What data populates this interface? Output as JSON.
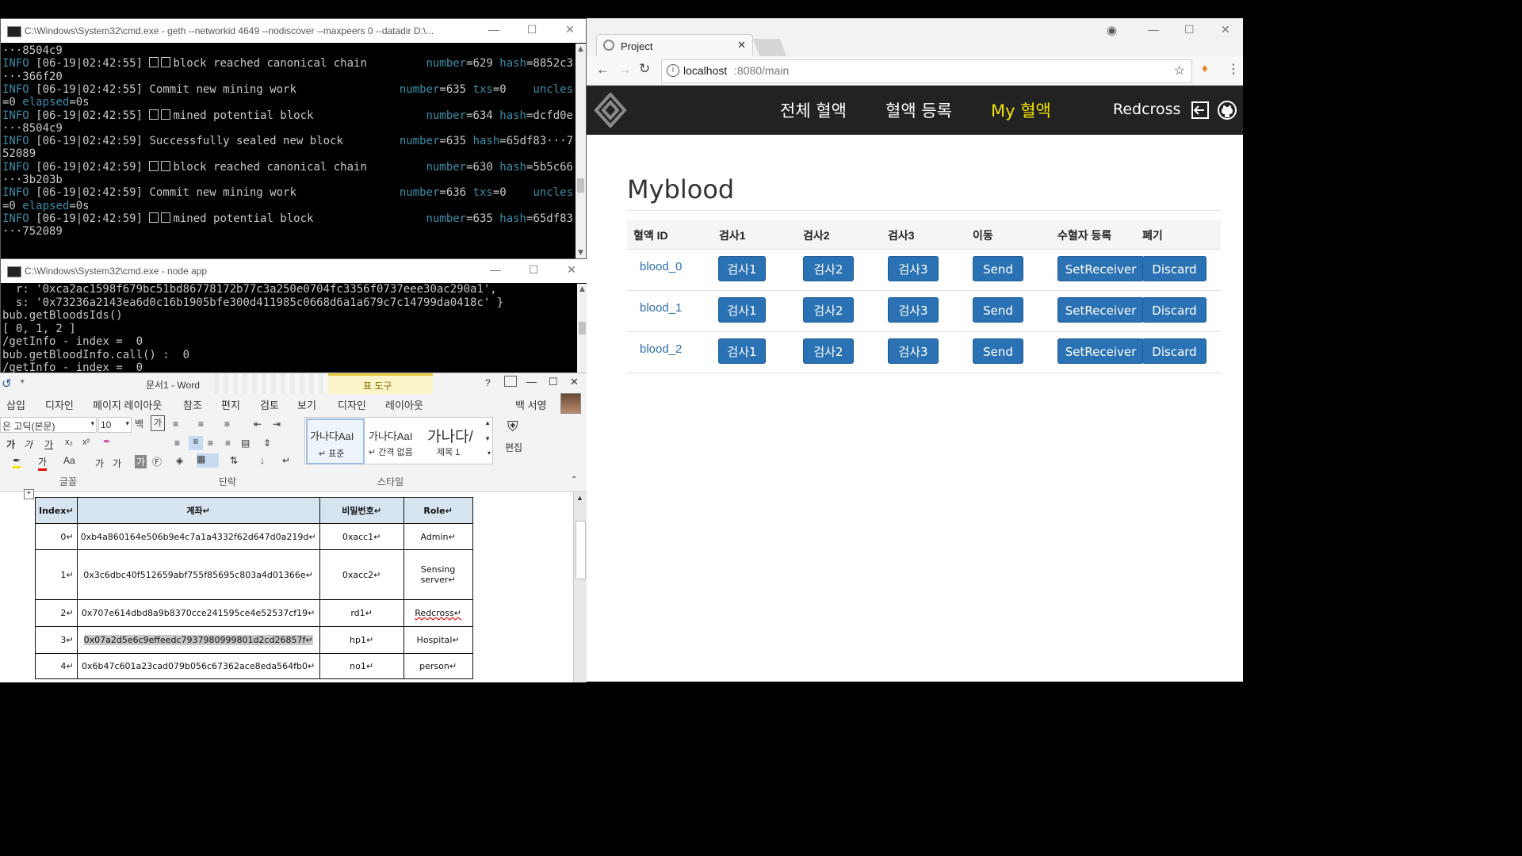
{
  "cmd1": {
    "title": "C:\\Windows\\System32\\cmd.exe - geth  --networkid 4649 --nodiscover --maxpeers 0 --datadir D:\\...",
    "lines": [
      {
        "pre": "",
        "text": "···8504c9",
        "kv": ""
      },
      {
        "pre": "INFO",
        "text": " [06-19|02:42:55] ",
        "msg": "block reached canonical chain",
        "sq": true,
        "kv1k": "number",
        "kv1v": "=629",
        "kv2k": "hash",
        "kv2v": "=8852c3"
      },
      {
        "pre": "",
        "text": "···366f20"
      },
      {
        "pre": "INFO",
        "text": " [06-19|02:42:55] ",
        "msg": "Commit new mining work",
        "sq": false,
        "kv1k": "number",
        "kv1v": "=635",
        "kv2k": "txs",
        "kv2v": "=0",
        "kv3k": "uncles"
      },
      {
        "pre": "",
        "text": "=0 ",
        "kvk": "elapsed",
        "kvv": "=0s"
      },
      {
        "pre": "INFO",
        "text": " [06-19|02:42:55] ",
        "msg": "mined potential block",
        "sq": true,
        "kv1k": "number",
        "kv1v": "=634",
        "kv2k": "hash",
        "kv2v": "=dcfd0e"
      },
      {
        "pre": "",
        "text": "···8504c9"
      },
      {
        "pre": "INFO",
        "text": " [06-19|02:42:59] ",
        "msg": "Successfully sealed new block",
        "sq": false,
        "kv1k": "number",
        "kv1v": "=635",
        "kv2k": "hash",
        "kv2v": "=65df83···7"
      },
      {
        "pre": "",
        "text": "52089"
      },
      {
        "pre": "INFO",
        "text": " [06-19|02:42:59] ",
        "msg": "block reached canonical chain",
        "sq": true,
        "kv1k": "number",
        "kv1v": "=630",
        "kv2k": "hash",
        "kv2v": "=5b5c66"
      },
      {
        "pre": "",
        "text": "···3b203b"
      },
      {
        "pre": "INFO",
        "text": " [06-19|02:42:59] ",
        "msg": "Commit new mining work",
        "sq": false,
        "kv1k": "number",
        "kv1v": "=636",
        "kv2k": "txs",
        "kv2v": "=0",
        "kv3k": "uncles"
      },
      {
        "pre": "",
        "text": "=0 ",
        "kvk": "elapsed",
        "kvv": "=0s"
      },
      {
        "pre": "INFO",
        "text": " [06-19|02:42:59] ",
        "msg": "mined potential block",
        "sq": true,
        "kv1k": "number",
        "kv1v": "=635",
        "kv2k": "hash",
        "kv2v": "=65df83"
      },
      {
        "pre": "",
        "text": "···752089"
      }
    ]
  },
  "cmd2": {
    "title": "C:\\Windows\\System32\\cmd.exe - node  app",
    "lines": [
      "  r: '0xca2ac1598f679bc51bd86778172b77c3a250e0704fc3356f0737eee30ac290a1',",
      "  s: '0x73236a2143ea6d0c16b1905bfe300d411985c0668d6a1a679c7c14799da0418c' }",
      "bub.getBloodsIds()",
      "[ 0, 1, 2 ]",
      "/getInfo - index =  0",
      "bub.getBloodInfo.call() :  0",
      "/getInfo - index =  0"
    ]
  },
  "word": {
    "title": "문서1 - Word",
    "context_tab": "표 도구",
    "help": "?",
    "tabs": [
      "삽입",
      "디자인",
      "페이지 레이아웃",
      "참조",
      "편지",
      "검토",
      "보기",
      "디자인",
      "레이아웃"
    ],
    "user": "백 서영",
    "font_name": "은 고딕(본문)",
    "font_size": "10",
    "groups": {
      "font": "글꼴",
      "paragraph": "단락",
      "styles": "스타일",
      "edit": "편집"
    },
    "styles": [
      {
        "sample": "가나다AaI",
        "name": "↵ 표준"
      },
      {
        "sample": "가나다AaI",
        "name": "↵ 간격 없음"
      },
      {
        "sample": "가나다/",
        "name": "제목 1"
      }
    ],
    "table": {
      "headers": [
        "Index↵",
        "계좌↵",
        "비밀번호↵",
        "Role↵"
      ],
      "rows": [
        [
          "0↵",
          "0xb4a860164e506b9e4c7a1a4332f62d647d0a219d↵",
          "0xacc1↵",
          "Admin↵"
        ],
        [
          "1↵",
          "0x3c6dbc40f512659abf755f85695c803a4d01366e↵",
          "0xacc2↵",
          "Sensing server↵"
        ],
        [
          "2↵",
          "0x707e614dbd8a9b8370cce241595ce4e52537cf19↵",
          "rd1↵",
          "Redcross↵"
        ],
        [
          "3↵",
          "0x07a2d5e6c9effeedc7937980999801d2cd26857f↵",
          "hp1↵",
          "Hospital↵"
        ],
        [
          "4↵",
          "0x6b47c601a23cad079b056c67362ace8eda564fb0↵",
          "no1↵",
          "person↵"
        ]
      ]
    }
  },
  "browser": {
    "tab_title": "Project",
    "url_host": "localhost",
    "url_path": ":8080/main",
    "nav": {
      "all": "전체 혈액",
      "register": "혈액 등록",
      "my": "My 혈액",
      "user": "Redcross"
    },
    "heading": "Myblood",
    "columns": [
      "혈액 ID",
      "검사1",
      "검사2",
      "검사3",
      "이동",
      "수혈자 등록",
      "폐기"
    ],
    "rows": [
      {
        "id": "blood_0",
        "b1": "검사1",
        "b2": "검사2",
        "b3": "검사3",
        "send": "Send",
        "setr": "SetReceiver",
        "discard": "Discard"
      },
      {
        "id": "blood_1",
        "b1": "검사1",
        "b2": "검사2",
        "b3": "검사3",
        "send": "Send",
        "setr": "SetReceiver",
        "discard": "Discard"
      },
      {
        "id": "blood_2",
        "b1": "검사1",
        "b2": "검사2",
        "b3": "검사3",
        "send": "Send",
        "setr": "SetReceiver",
        "discard": "Discard"
      }
    ],
    "colors": {
      "accent": "#f2e200",
      "button": "#2a72b4",
      "navbar": "#222222",
      "link": "#2f6faf"
    }
  }
}
